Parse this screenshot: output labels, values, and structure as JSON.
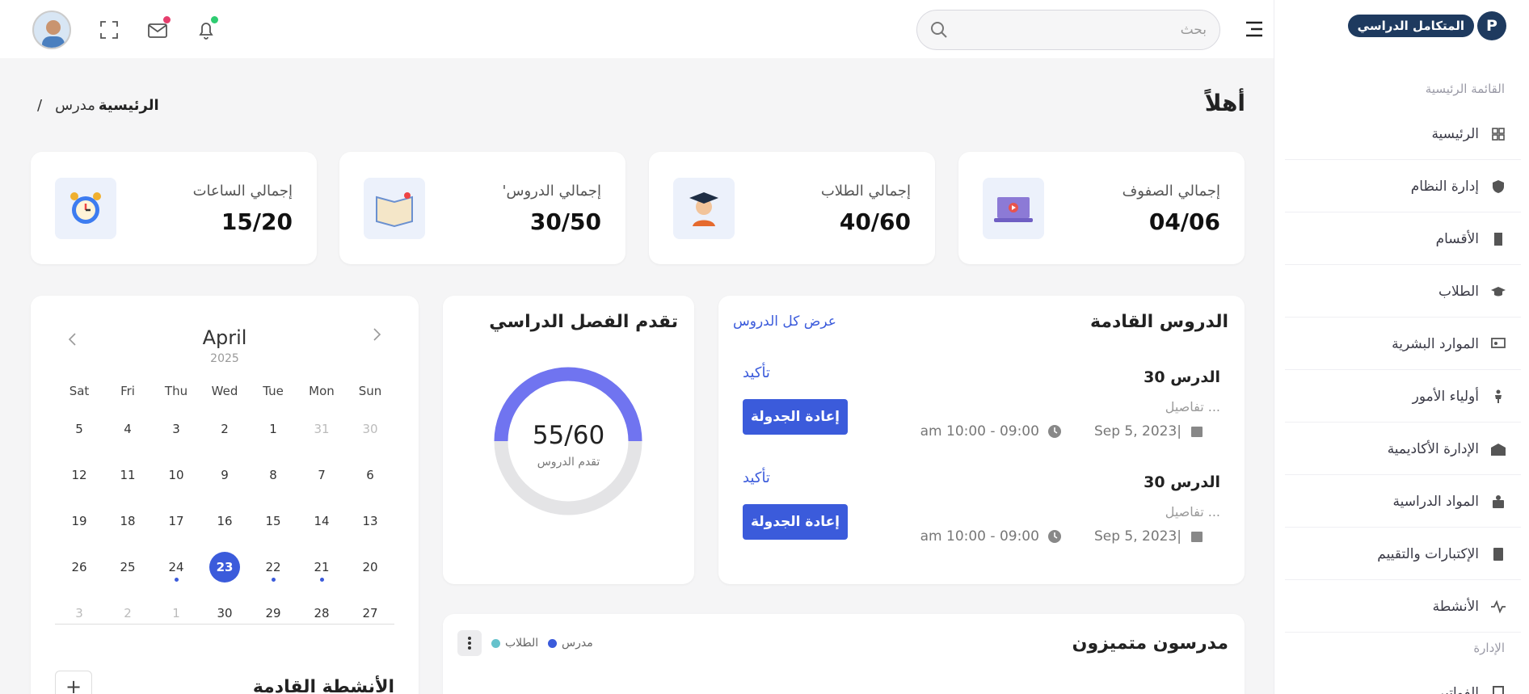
{
  "sidebar": {
    "logo_mark": "P",
    "logo_text": "المتكامل الدراسي",
    "section_main": "القائمة الرئيسية",
    "section_admin": "الإدارة",
    "items": [
      {
        "label": "الرئيسية",
        "icon": "grid-icon"
      },
      {
        "label": "إدارة النظام",
        "icon": "shield-icon"
      },
      {
        "label": "الأقسام",
        "icon": "building-icon"
      },
      {
        "label": "الطلاب",
        "icon": "graduation-cap-icon"
      },
      {
        "label": "الموارد البشرية",
        "icon": "presentation-icon"
      },
      {
        "label": "أولياء الأمور",
        "icon": "person-icon"
      },
      {
        "label": "الإدارة الأكاديمية",
        "icon": "school-icon"
      },
      {
        "label": "المواد الدراسية",
        "icon": "book-user-icon"
      },
      {
        "label": "الإكتبارات والتقييم",
        "icon": "notebook-icon"
      },
      {
        "label": "الأنشطة",
        "icon": "activity-icon"
      }
    ],
    "last_item": "الفواتير"
  },
  "topbar": {
    "search_placeholder": "بحث"
  },
  "header": {
    "title": "أهلاً",
    "breadcrumb_home": "الرئيسية",
    "breadcrumb_current": "مدرس",
    "breadcrumb_sep": "/"
  },
  "stats": [
    {
      "title": "إجمالي الصفوف",
      "value": "04/06",
      "icon": "laptop-video-icon"
    },
    {
      "title": "إجمالي الطلاب",
      "value": "40/60",
      "icon": "graduate-student-icon"
    },
    {
      "title": "'إجمالي الدروس",
      "value": "30/50",
      "icon": "open-book-icon"
    },
    {
      "title": "إجمالي الساعات",
      "value": "15/20",
      "icon": "alarm-clock-icon"
    }
  ],
  "upcoming": {
    "title": "الدروس القادمة",
    "view_all": "عرض كل الدروس",
    "lessons": [
      {
        "title": "الدرس 30",
        "details": "تفاصيل ...",
        "date": "Sep 5, 2023|",
        "time": "am 10:00 - 09:00",
        "confirm": "تأكيد",
        "reschedule": "إعادة الجدولة"
      },
      {
        "title": "الدرس 30",
        "details": "تفاصيل ...",
        "date": "Sep 5, 2023|",
        "time": "am 10:00 - 09:00",
        "confirm": "تأكيد",
        "reschedule": "إعادة الجدولة"
      }
    ]
  },
  "progress": {
    "title": "تقدم الفصل الدراسي",
    "value_text": "55/60",
    "label": "تقدم الدروس",
    "fraction": 0.5,
    "color": "#7074f0",
    "track": "#e4e4e6"
  },
  "calendar": {
    "month": "April",
    "year": "2025",
    "weekdays": [
      "Sun",
      "Mon",
      "Tue",
      "Wed",
      "Thu",
      "Fri",
      "Sat"
    ],
    "weeks": [
      [
        {
          "d": "30",
          "m": true
        },
        {
          "d": "31",
          "m": true
        },
        {
          "d": "1"
        },
        {
          "d": "2"
        },
        {
          "d": "3"
        },
        {
          "d": "4"
        },
        {
          "d": "5"
        }
      ],
      [
        {
          "d": "6"
        },
        {
          "d": "7"
        },
        {
          "d": "8"
        },
        {
          "d": "9"
        },
        {
          "d": "10"
        },
        {
          "d": "11"
        },
        {
          "d": "12"
        }
      ],
      [
        {
          "d": "13"
        },
        {
          "d": "14"
        },
        {
          "d": "15"
        },
        {
          "d": "16"
        },
        {
          "d": "17"
        },
        {
          "d": "18"
        },
        {
          "d": "19"
        }
      ],
      [
        {
          "d": "20"
        },
        {
          "d": "21",
          "e": true
        },
        {
          "d": "22",
          "e": true
        },
        {
          "d": "23",
          "s": true
        },
        {
          "d": "24",
          "e": true
        },
        {
          "d": "25"
        },
        {
          "d": "26"
        }
      ],
      [
        {
          "d": "27"
        },
        {
          "d": "28"
        },
        {
          "d": "29"
        },
        {
          "d": "30"
        },
        {
          "d": "1",
          "m": true
        },
        {
          "d": "2",
          "m": true
        },
        {
          "d": "3",
          "m": true
        }
      ]
    ],
    "activities_title": "الأنشطة القادمة"
  },
  "teachers": {
    "title": "مدرسون متميزون",
    "legend_teacher": "مدرس",
    "legend_student": "الطلاب",
    "teacher_color": "#3b5bdb",
    "student_color": "#66c2cc"
  }
}
